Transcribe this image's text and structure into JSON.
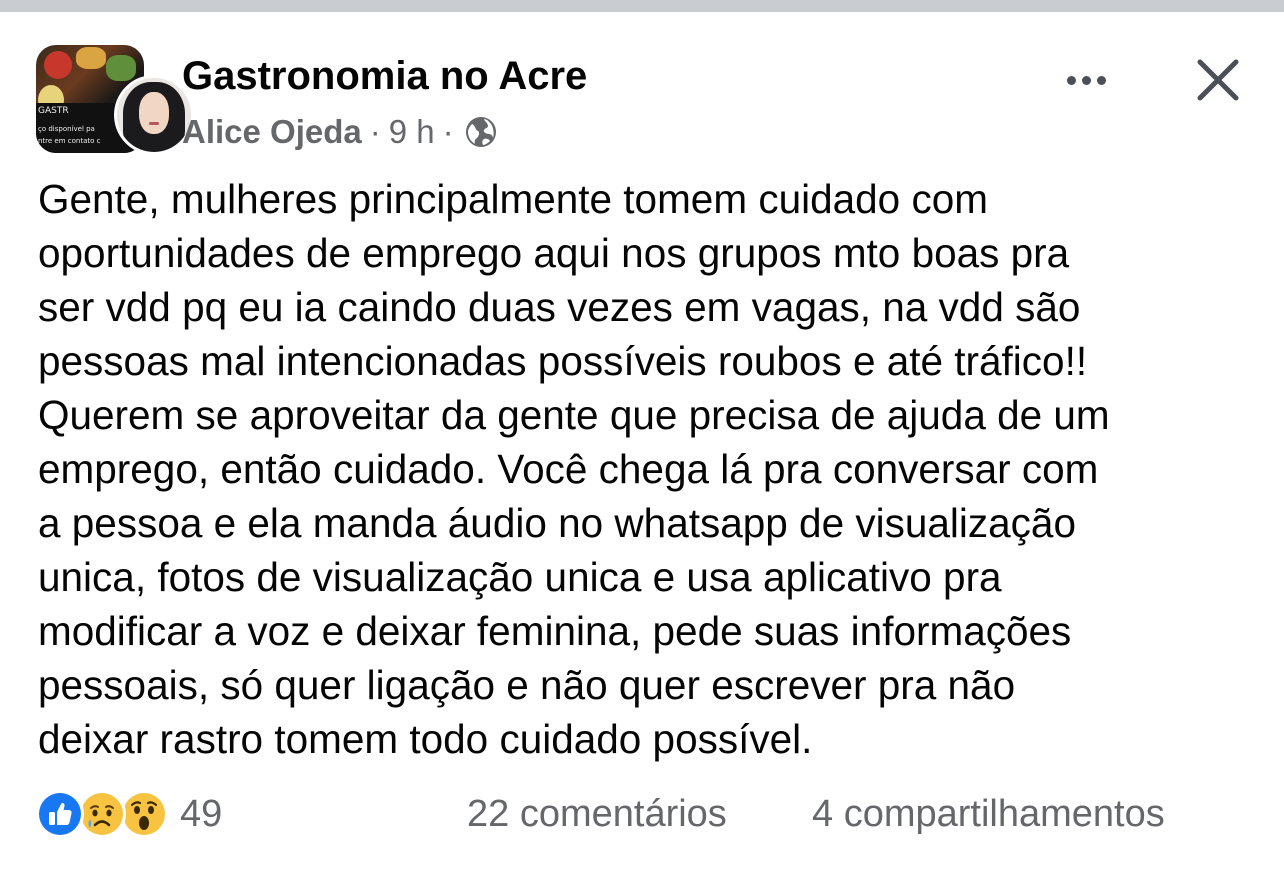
{
  "header": {
    "group_name": "Gastronomia no Acre",
    "author": "Alice Ojeda",
    "separator": "·",
    "time": "9 h",
    "audience_icon": "globe-icon",
    "more_icon": "more-horizontal-icon",
    "close_icon": "close-icon"
  },
  "group_avatar": {
    "label_line1": "GASTR",
    "label_line2": "ço disponível pa",
    "label_line3": "ntre em contato c"
  },
  "post": {
    "text": "Gente, mulheres principalmente tomem cuidado com\noportunidades de emprego aqui nos grupos mto boas pra\nser vdd pq eu ia caindo duas vezes em vagas, na vdd são\npessoas mal intencionadas possíveis roubos e até tráfico!!\nQuerem se aproveitar da gente que precisa de ajuda de um\nemprego, então cuidado. Você chega lá pra conversar com\na pessoa e ela manda áudio no whatsapp de visualização\nunica, fotos de visualização unica e usa aplicativo pra\nmodificar a voz e deixar feminina, pede suas informações\npessoais, só quer ligação e não quer escrever pra não\ndeixar rastro tomem todo cuidado possível."
  },
  "footer": {
    "reactions": [
      "like-icon",
      "sad-icon",
      "wow-icon"
    ],
    "reaction_count": "49",
    "comments": "22 comentários",
    "shares": "4 compartilhamentos"
  },
  "colors": {
    "like_blue": "#1877f2",
    "reaction_yellow": "#f7c341",
    "secondary_text": "#65676b",
    "primary_text": "#050505"
  }
}
